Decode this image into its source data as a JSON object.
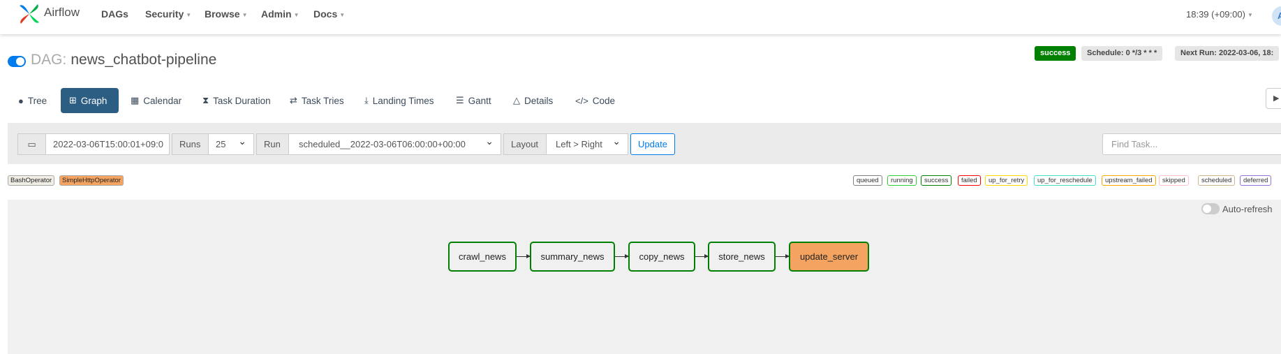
{
  "navbar": {
    "brand": "Airflow",
    "menus": [
      "DAGs",
      "Security",
      "Browse",
      "Admin",
      "Docs"
    ],
    "clock": "18:39 (+09:00)",
    "avatar": "A"
  },
  "dag": {
    "prefix": "DAG:",
    "name": "news_chatbot-pipeline",
    "paused": false,
    "badges": {
      "status": "success",
      "schedule": "Schedule: 0 */3 * * *",
      "next_run": "Next Run: 2022-03-06, 18:"
    }
  },
  "tabs": [
    "Tree",
    "Graph",
    "Calendar",
    "Task Duration",
    "Task Tries",
    "Landing Times",
    "Gantt",
    "Details",
    "Code"
  ],
  "active_tab": "Graph",
  "controls": {
    "base_date": "2022-03-06T15:00:01+09:0",
    "runs_label": "Runs",
    "runs_value": "25",
    "run_label": "Run",
    "run_value": "scheduled__2022-03-06T06:00:00+00:00",
    "layout_label": "Layout",
    "layout_value": "Left > Right",
    "update": "Update",
    "find_placeholder": "Find Task..."
  },
  "operators": [
    {
      "name": "BashOperator",
      "color": "#f0ede4"
    },
    {
      "name": "SimpleHttpOperator",
      "color": "#f4a460"
    }
  ],
  "states": [
    {
      "name": "queued",
      "color": "#808080"
    },
    {
      "name": "running",
      "color": "#32cd32"
    },
    {
      "name": "success",
      "color": "#008000"
    },
    {
      "name": "failed",
      "color": "#ff0000"
    },
    {
      "name": "up_for_retry",
      "color": "#ffd700"
    },
    {
      "name": "up_for_reschedule",
      "color": "#40e0d0"
    },
    {
      "name": "upstream_failed",
      "color": "#ffa500"
    },
    {
      "name": "skipped",
      "color": "#ffc0cb"
    },
    {
      "name": "scheduled",
      "color": "#d2b48c"
    },
    {
      "name": "deferred",
      "color": "#9370db"
    }
  ],
  "graph": {
    "auto_refresh": "Auto-refresh",
    "tasks": [
      {
        "id": "crawl_news",
        "operator": "BashOperator",
        "state": "success"
      },
      {
        "id": "summary_news",
        "operator": "BashOperator",
        "state": "success"
      },
      {
        "id": "copy_news",
        "operator": "BashOperator",
        "state": "success"
      },
      {
        "id": "store_news",
        "operator": "BashOperator",
        "state": "success"
      },
      {
        "id": "update_server",
        "operator": "SimpleHttpOperator",
        "state": "success"
      }
    ]
  }
}
